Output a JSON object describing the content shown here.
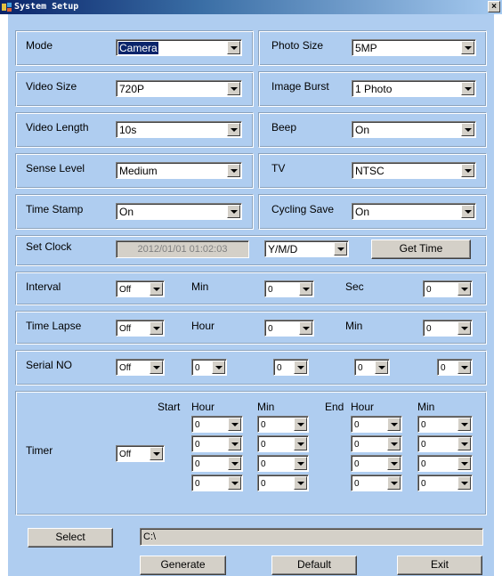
{
  "window": {
    "title": "System Setup",
    "close": "×"
  },
  "settings": {
    "mode": {
      "label": "Mode",
      "value": "Camera"
    },
    "photo_size": {
      "label": "Photo Size",
      "value": "5MP"
    },
    "video_size": {
      "label": "Video Size",
      "value": "720P"
    },
    "image_burst": {
      "label": "Image Burst",
      "value": "1 Photo"
    },
    "video_length": {
      "label": "Video Length",
      "value": "10s"
    },
    "beep": {
      "label": "Beep",
      "value": "On"
    },
    "sense_level": {
      "label": "Sense Level",
      "value": "Medium"
    },
    "tv": {
      "label": "TV",
      "value": "NTSC"
    },
    "time_stamp": {
      "label": "Time Stamp",
      "value": "On"
    },
    "cycling_save": {
      "label": "Cycling Save",
      "value": "On"
    }
  },
  "clock": {
    "label": "Set Clock",
    "datetime": "2012/01/01  01:02:03",
    "format": "Y/M/D",
    "get_time": "Get Time"
  },
  "interval": {
    "label": "Interval",
    "value": "Off",
    "min_label": "Min",
    "min": "0",
    "sec_label": "Sec",
    "sec": "0"
  },
  "time_lapse": {
    "label": "Time Lapse",
    "value": "Off",
    "hour_label": "Hour",
    "hour": "0",
    "min_label": "Min",
    "min": "0"
  },
  "serial": {
    "label": "Serial NO",
    "value": "Off",
    "d1": "0",
    "d2": "0",
    "d3": "0",
    "d4": "0"
  },
  "timer": {
    "label": "Timer",
    "value": "Off",
    "start": "Start",
    "end": "End",
    "hour": "Hour",
    "min": "Min",
    "start_hour": [
      "0",
      "0",
      "0",
      "0"
    ],
    "start_min": [
      "0",
      "0",
      "0",
      "0"
    ],
    "end_hour": [
      "0",
      "0",
      "0",
      "0"
    ],
    "end_min": [
      "0",
      "0",
      "0",
      "0"
    ]
  },
  "output": {
    "select": "Select",
    "path": "C:\\"
  },
  "actions": {
    "generate": "Generate",
    "default": "Default",
    "exit": "Exit"
  }
}
